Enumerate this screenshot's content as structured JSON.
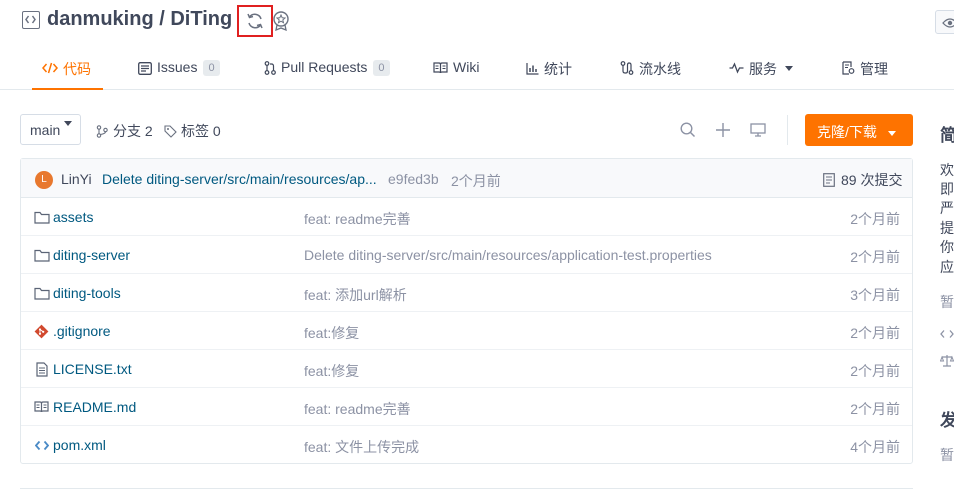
{
  "header": {
    "repo_title": "danmuking / DiTing",
    "repo_type_icon": "code-repo-icon",
    "sync_icon": "sync-icon",
    "badge_icon": "recommend-badge-icon",
    "watch_icon": "eye-icon"
  },
  "tabs": [
    {
      "label": "代码",
      "icon": "code-icon",
      "active": true
    },
    {
      "label": "Issues",
      "icon": "issues-icon",
      "count": "0"
    },
    {
      "label": "Pull Requests",
      "icon": "pull-request-icon",
      "count": "0"
    },
    {
      "label": "Wiki",
      "icon": "book-icon"
    },
    {
      "label": "统计",
      "icon": "bar-chart-icon"
    },
    {
      "label": "流水线",
      "icon": "pipeline-icon"
    },
    {
      "label": "服务",
      "icon": "pulse-icon",
      "dropdown": true
    },
    {
      "label": "管理",
      "icon": "settings-doc-icon"
    }
  ],
  "toolbar": {
    "branch": "main",
    "branches_label": "分支 2",
    "tags_label": "标签 0",
    "clone_label": "克隆/下载"
  },
  "latest_commit": {
    "avatar_letter": "L",
    "author": "LinYi",
    "message": "Delete diting-server/src/main/resources/ap...",
    "sha": "e9fed3b",
    "time": "2个月前",
    "total_commits": "89 次提交"
  },
  "files": [
    {
      "type": "folder",
      "name": "assets",
      "message": "feat: readme完善",
      "time": "2个月前"
    },
    {
      "type": "folder",
      "name": "diting-server",
      "message": "Delete diting-server/src/main/resources/application-test.properties",
      "time": "2个月前"
    },
    {
      "type": "folder",
      "name": "diting-tools",
      "message": "feat: 添加url解析",
      "time": "3个月前"
    },
    {
      "type": "git",
      "name": ".gitignore",
      "message": "feat:修复",
      "time": "2个月前"
    },
    {
      "type": "text",
      "name": "LICENSE.txt",
      "message": "feat:修复",
      "time": "2个月前"
    },
    {
      "type": "readme",
      "name": "README.md",
      "message": "feat: readme完善",
      "time": "2个月前"
    },
    {
      "type": "code",
      "name": "pom.xml",
      "message": "feat: 文件上传完成",
      "time": "4个月前"
    }
  ],
  "sidebar": {
    "heading_intro": "简",
    "intro_lines": [
      "欢",
      "即",
      "严",
      "提",
      "你",
      "应"
    ],
    "no_desc": "暂",
    "heading_release": "发",
    "no_release": "暂"
  },
  "colors": {
    "accent": "#fe7300",
    "link": "#005980",
    "highlight_box": "#e02020"
  }
}
